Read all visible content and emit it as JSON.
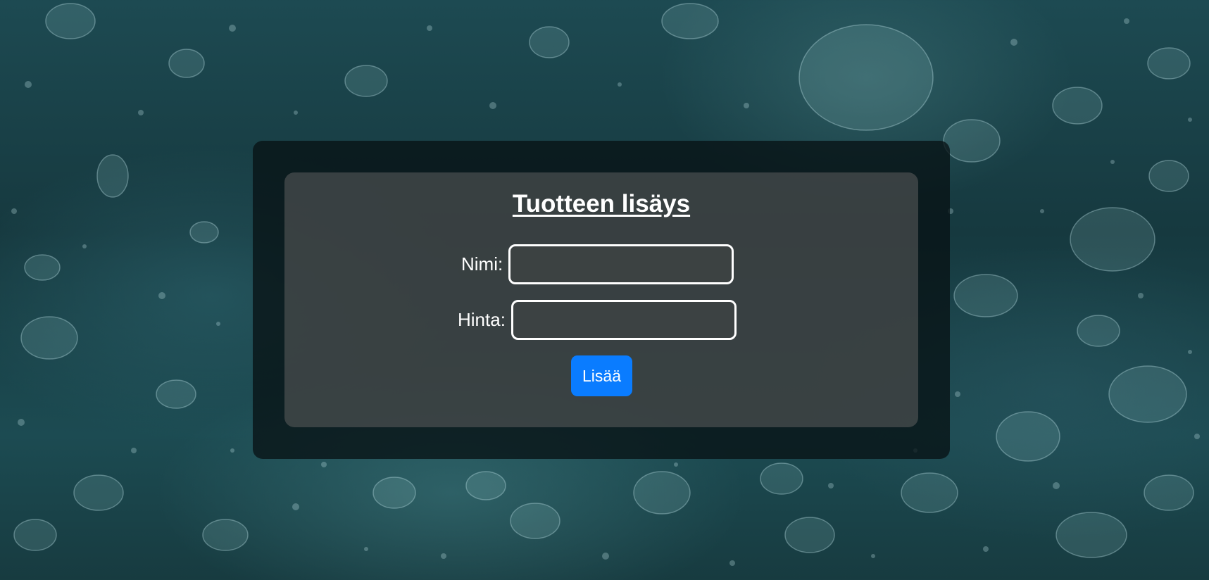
{
  "form": {
    "title": "Tuotteen lisäys",
    "name_label": "Nimi:",
    "name_value": "",
    "price_label": "Hinta:",
    "price_value": "",
    "submit_label": "Lisää"
  },
  "colors": {
    "button": "#0a7cff",
    "text": "#ffffff",
    "water": "#1d4a52"
  },
  "background": {
    "icon": "underwater-bubbles-photo"
  }
}
